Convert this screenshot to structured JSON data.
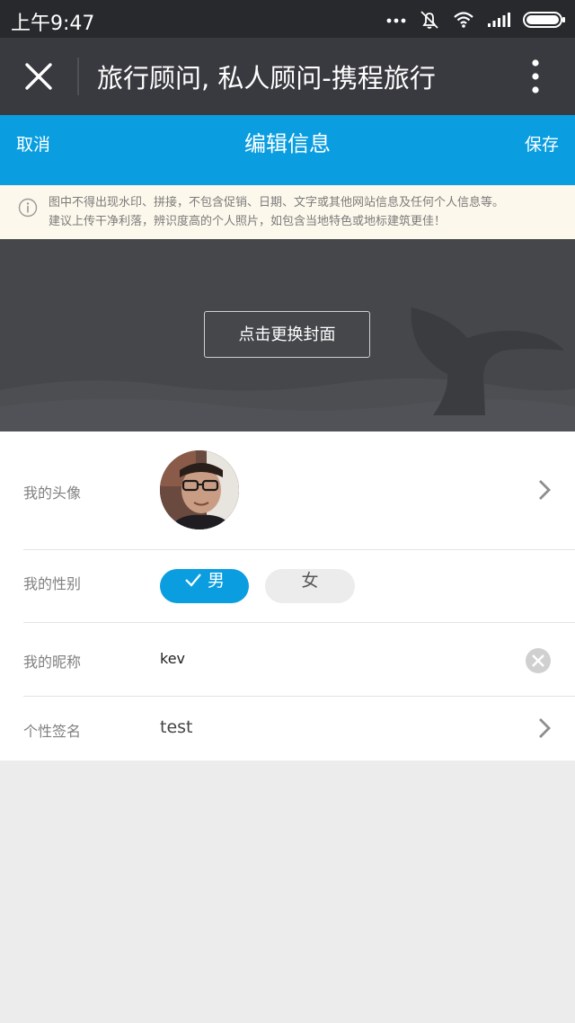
{
  "status_bar": {
    "time": "上午9:47",
    "icons": [
      "more-dots-icon",
      "mute-icon",
      "wifi-icon",
      "signal-icon",
      "battery-icon"
    ]
  },
  "title_bar": {
    "title": "旅行顾问, 私人顾问-携程旅行"
  },
  "header": {
    "cancel_label": "取消",
    "title": "编辑信息",
    "save_label": "保存",
    "color": "#0a9ee0"
  },
  "notice": {
    "line1": "图中不得出现水印、拼接，不包含促销、日期、文字或其他网站信息及任何个人信息等。",
    "line2": "建议上传干净利落，辨识度高的个人照片，如包含当地特色或地标建筑更佳！"
  },
  "cover": {
    "change_label": "点击更换封面"
  },
  "form": {
    "avatar_label": "我的头像",
    "gender_label": "我的性别",
    "gender_options": {
      "male": "男",
      "female": "女"
    },
    "gender_selected": "男",
    "nickname_label": "我的昵称",
    "nickname_value": "kev",
    "signature_label": "个性签名",
    "signature_value": "test"
  }
}
